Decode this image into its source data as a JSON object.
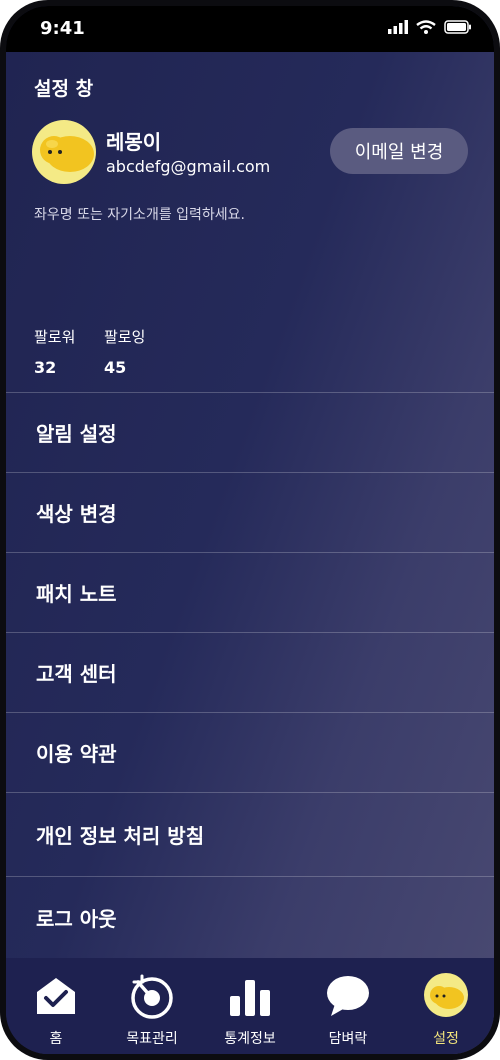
{
  "status_bar": {
    "time": "9:41"
  },
  "header": {
    "title": "설정 창"
  },
  "profile": {
    "name": "레몽이",
    "email": "abcdefg@gmail.com",
    "change_email_label": "이메일 변경",
    "bio_placeholder": "좌우명 또는 자기소개를 입력하세요."
  },
  "stats": {
    "followers_label": "팔로워",
    "followers_count": "32",
    "following_label": "팔로잉",
    "following_count": "45"
  },
  "menu": {
    "items": [
      {
        "label": "알림 설정"
      },
      {
        "label": "색상 변경"
      },
      {
        "label": "패치 노트"
      },
      {
        "label": "고객 센터"
      },
      {
        "label": "이용 약관"
      },
      {
        "label": "개인 정보 처리 방침"
      },
      {
        "label": "로그 아웃"
      }
    ]
  },
  "tabbar": {
    "tabs": [
      {
        "label": "홈",
        "icon": "home-check-icon"
      },
      {
        "label": "목표관리",
        "icon": "target-icon"
      },
      {
        "label": "통계정보",
        "icon": "bar-chart-icon"
      },
      {
        "label": "담벼락",
        "icon": "chat-bubble-icon"
      },
      {
        "label": "설정",
        "icon": "lemon-avatar-icon"
      }
    ],
    "active_index": 4
  },
  "colors": {
    "background": "#252a5a",
    "accent": "#f1e37c",
    "avatar_bg": "#f4ea86",
    "button_bg": "#5a5b80"
  }
}
